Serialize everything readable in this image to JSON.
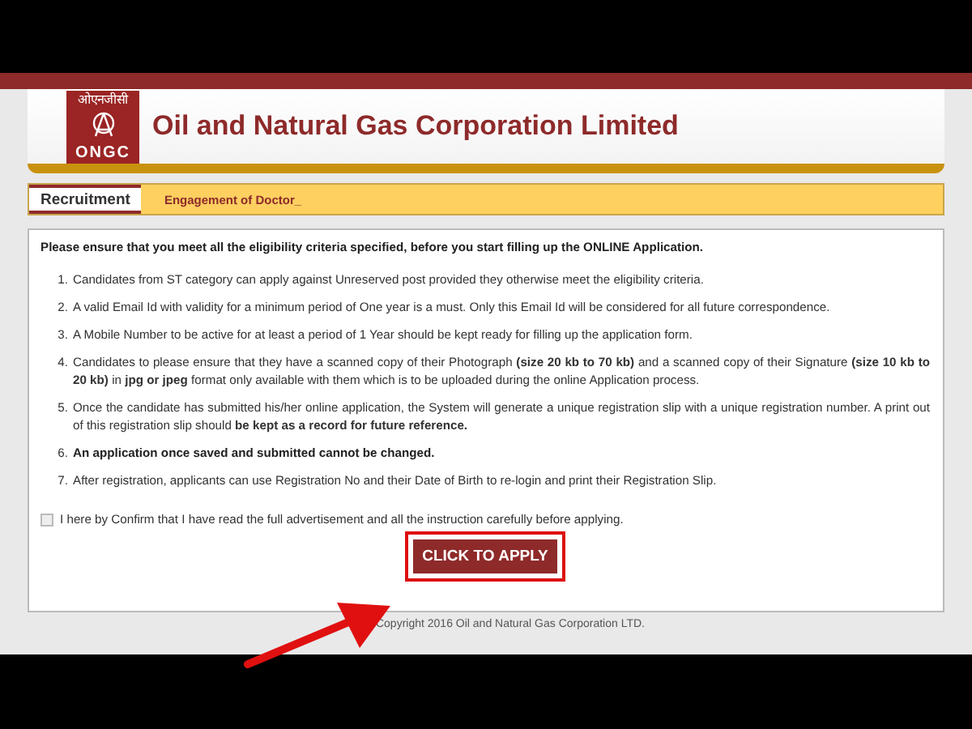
{
  "header": {
    "logo_top": "ओएनजीसी",
    "logo_bottom": "ONGC",
    "title": "Oil and Natural Gas Corporation Limited"
  },
  "tabs": [
    {
      "label": "Recruitment",
      "selected": true
    }
  ],
  "breadcrumb": "Engagement of Doctor_",
  "notice": "Please ensure that you meet all the eligibility criteria specified, before you start filling up the ONLINE Application.",
  "instructions": [
    {
      "number": "1.",
      "text": "Candidates from ST category can apply against Unreserved post provided they otherwise meet the eligibility criteria.",
      "emphasis": false
    },
    {
      "number": "2.",
      "text": "A valid Email Id with validity for a minimum period of One year is a must. Only this Email Id will be considered for all future correspondence.",
      "emphasis": false
    },
    {
      "number": "3.",
      "text": "A Mobile Number to be active for at least a period of 1 Year should be kept ready for filling up the application form.",
      "emphasis": false
    },
    {
      "number": "4.",
      "text": "Candidates to please ensure that they have a scanned copy of their Photograph **(size 20 kb to 70 kb)** and a scanned copy of their Signature **(size 10 kb to 20 kb)** in **jpg or jpeg** format only available with them which is to be uploaded during the online Application process.",
      "emphasis": false
    },
    {
      "number": "5.",
      "text": "Once the candidate has submitted his/her online application, the System will generate a unique registration slip with a unique registration number. A print out of this registration slip should **be kept as a record for future reference.**",
      "emphasis": false
    },
    {
      "number": "6.",
      "text": "An application once saved and submitted cannot be changed.",
      "emphasis": true
    },
    {
      "number": "7.",
      "text": "After registration, applicants can use Registration No and their Date of Birth to re-login and print their Registration Slip.",
      "emphasis": false
    }
  ],
  "confirm": {
    "label": "I here by Confirm that I have read the full advertisement and all the instruction carefully before applying.",
    "checked": false
  },
  "apply_button": "CLICK TO APPLY",
  "copyright": "Copyright 2016 Oil and Natural Gas Corporation LTD."
}
